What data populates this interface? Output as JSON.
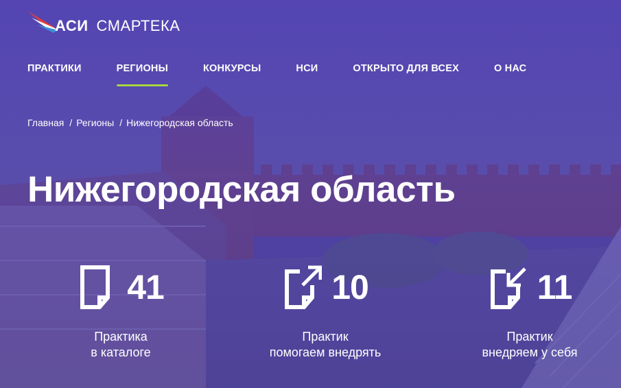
{
  "brand": {
    "name": "АСИ",
    "product": "СМАРТЕКА"
  },
  "nav": {
    "items": [
      {
        "label": "ПРАКТИКИ",
        "active": false
      },
      {
        "label": "РЕГИОНЫ",
        "active": true
      },
      {
        "label": "КОНКУРСЫ",
        "active": false
      },
      {
        "label": "НСИ",
        "active": false
      },
      {
        "label": "ОТКРЫТО ДЛЯ ВСЕХ",
        "active": false
      },
      {
        "label": "О НАС",
        "active": false
      }
    ]
  },
  "breadcrumb": {
    "items": [
      "Главная",
      "Регионы",
      "Нижегородская область"
    ],
    "separator": "/"
  },
  "page": {
    "title": "Нижегородская область"
  },
  "stats": [
    {
      "icon": "document-icon",
      "value": "41",
      "label_line1": "Практика",
      "label_line2": "в каталоге"
    },
    {
      "icon": "document-export-icon",
      "value": "10",
      "label_line1": "Практик",
      "label_line2": "помогаем внедрять"
    },
    {
      "icon": "document-import-icon",
      "value": "11",
      "label_line1": "Практик",
      "label_line2": "внедряем у себя"
    }
  ],
  "colors": {
    "overlay": "#4e3eb2",
    "accent_underline": "#a6d640",
    "text": "#ffffff"
  }
}
